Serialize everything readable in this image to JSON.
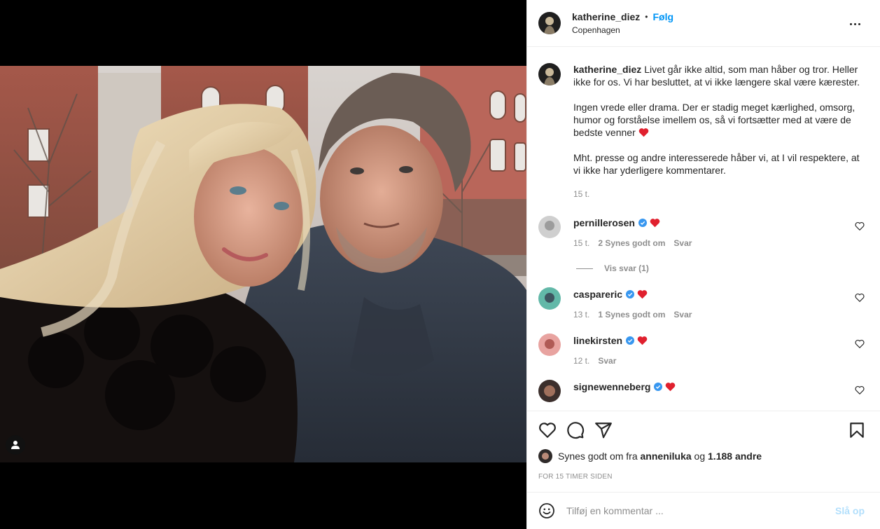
{
  "post": {
    "author": "katherine_diez",
    "dot": "•",
    "follow_label": "Følg",
    "location": "Copenhagen"
  },
  "caption": {
    "username": "katherine_diez",
    "para1": "Livet går ikke altid, som man håber og tror. Heller ikke for os. Vi har besluttet, at vi ikke længere skal være kærester.",
    "para2": "Ingen vrede eller drama. Der er stadig meget kærlighed, omsorg, humor og forståelse imellem os, så vi fortsætter med at være de bedste venner",
    "para3": "Mht. presse og andre interesserede håber vi, at I vil respektere, at vi ikke har yderligere kommentarer.",
    "time": "15 t."
  },
  "comments": [
    {
      "username": "pernillerosen",
      "time": "15 t.",
      "likes": "2 Synes godt om",
      "reply": "Svar",
      "avatar_color": "#bfbfbf"
    },
    {
      "username": "caspareric",
      "time": "13 t.",
      "likes": "1 Synes godt om",
      "reply": "Svar",
      "avatar_color": "#4aa9a0"
    },
    {
      "username": "linekirsten",
      "time": "12 t.",
      "likes": "",
      "reply": "Svar",
      "avatar_color": "#e59a9a"
    },
    {
      "username": "signewenneberg",
      "time": "",
      "likes": "",
      "reply": "",
      "avatar_color": "#3c2f2c"
    }
  ],
  "view_replies": "Vis svar (1)",
  "liked_by": {
    "prefix": "Synes godt om fra",
    "user": "anneniluka",
    "connector": "og",
    "others": "1.188 andre"
  },
  "posted_ago": "FOR 15 TIMER SIDEN",
  "add_comment": {
    "placeholder": "Tilføj en kommentar ...",
    "post_label": "Slå op"
  },
  "colors": {
    "link_blue": "#0095f6",
    "heart_red": "#ed4956",
    "verified_blue": "#3897f0",
    "muted": "#8e8e8e"
  }
}
